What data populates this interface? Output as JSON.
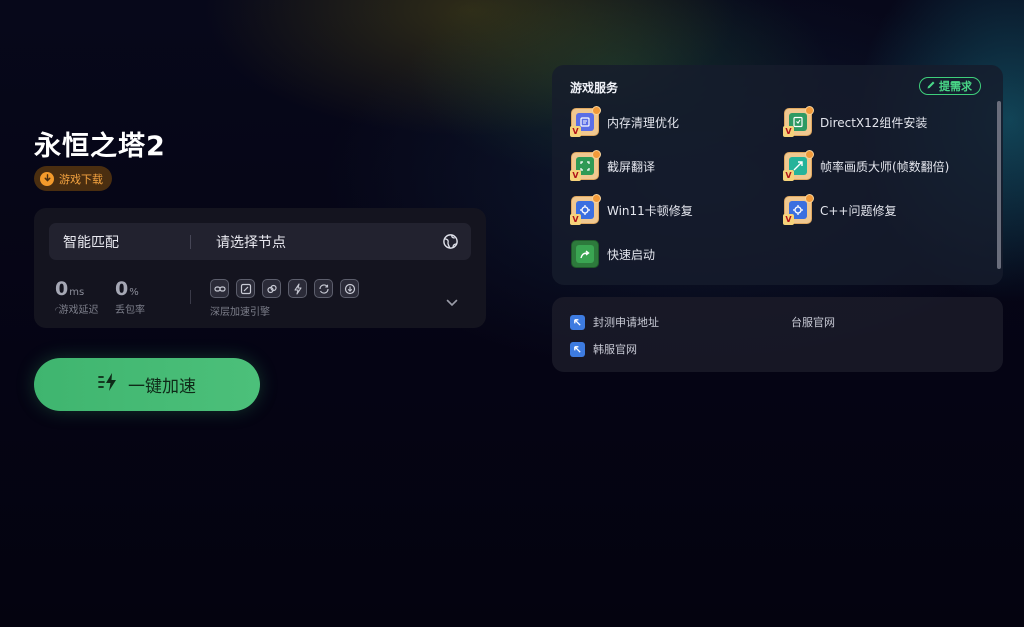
{
  "game": {
    "title": "永恒之塔2",
    "download_label": "游戏下载"
  },
  "route": {
    "mode_label": "智能匹配",
    "node_placeholder": "请选择节点",
    "latency": {
      "value": "0",
      "unit": "ms",
      "label": "游戏延迟"
    },
    "packet_loss": {
      "value": "0",
      "unit": "%",
      "label": "丢包率"
    },
    "engine_icons": [
      "link-icon",
      "screen-icon",
      "chain-icon",
      "bolt-icon",
      "refresh-icon",
      "download-icon"
    ],
    "engine_label": "深层加速引擎"
  },
  "boost_button": {
    "label": "一键加速"
  },
  "services": {
    "title": "游戏服务",
    "request_label": "提需求",
    "items": [
      {
        "label": "内存清理优化",
        "icon": "memory-clean-icon"
      },
      {
        "label": "DirectX12组件安装",
        "icon": "directx-install-icon"
      },
      {
        "label": "截屏翻译",
        "icon": "screenshot-translate-icon"
      },
      {
        "label": "帧率画质大师(帧数翻倍)",
        "icon": "framerate-master-icon"
      },
      {
        "label": "Win11卡顿修复",
        "icon": "win11-fix-icon"
      },
      {
        "label": "C++问题修复",
        "icon": "cpp-fix-icon"
      },
      {
        "label": "快速启动",
        "icon": "quick-launch-icon"
      }
    ]
  },
  "links": {
    "items": [
      {
        "label": "封测申请地址",
        "icon": "external-link-icon"
      },
      {
        "label": "台服官网",
        "icon": ""
      },
      {
        "label": "韩服官网",
        "icon": "external-link-icon"
      }
    ]
  },
  "colors": {
    "accent_green": "#3fb56f",
    "download_orange": "#f39a2b",
    "request_green": "#3ecf7b"
  }
}
